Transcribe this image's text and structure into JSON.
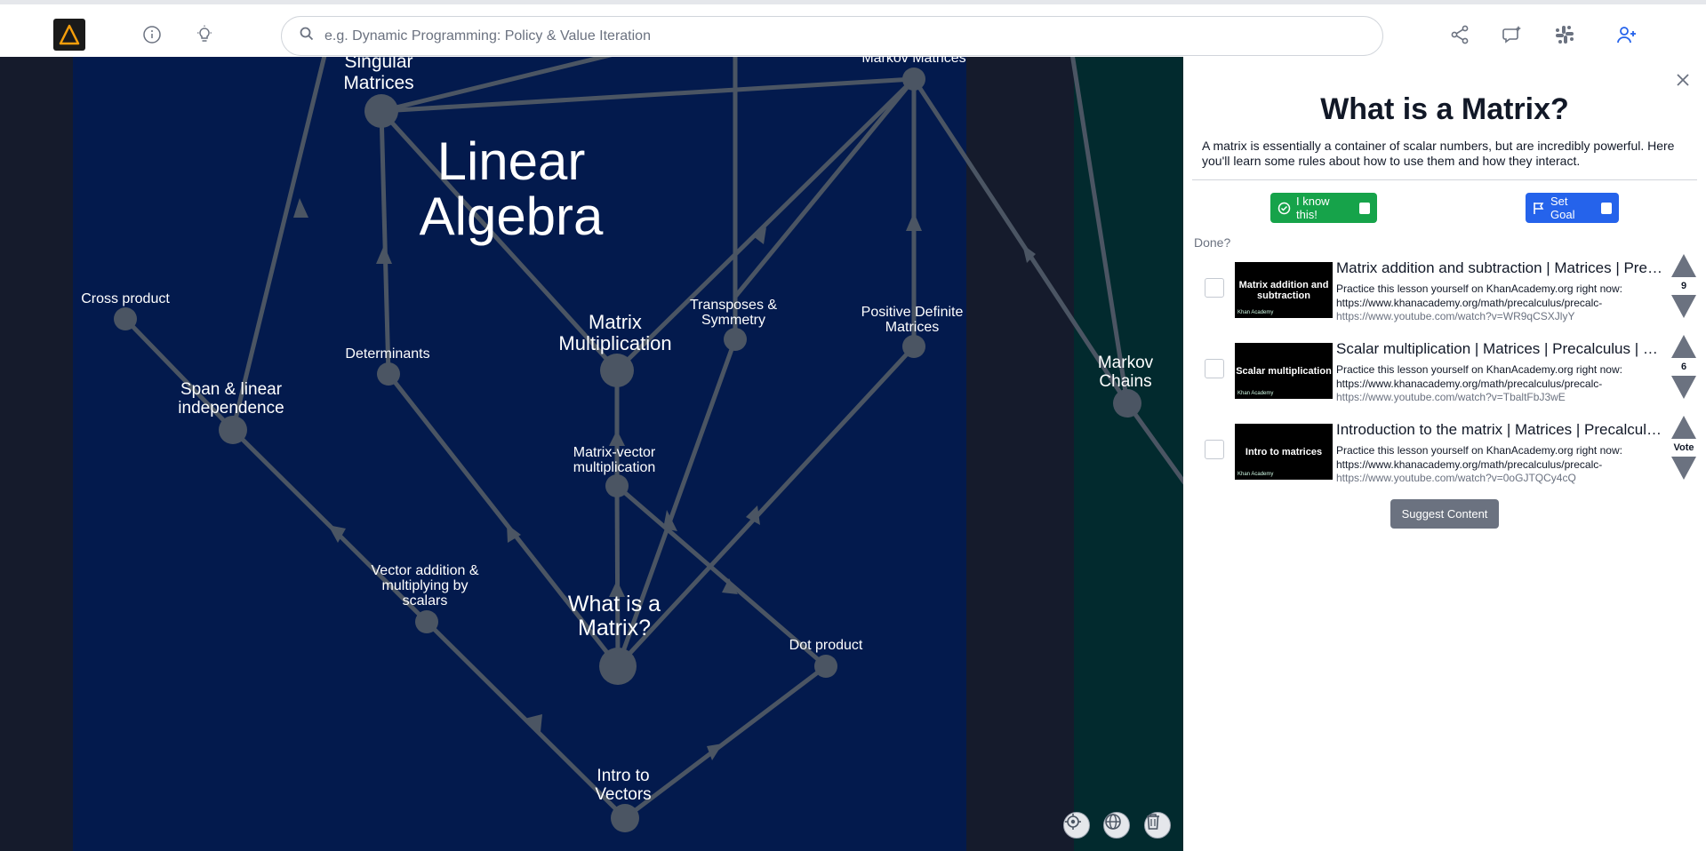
{
  "search": {
    "placeholder": "e.g. Dynamic Programming: Policy & Value Iteration"
  },
  "graph": {
    "region_title_line1": "Linear",
    "region_title_line2": "Algebra",
    "nodes": {
      "singular_matrices": [
        "Singular",
        "Matrices"
      ],
      "markov_matrices": "Markov Matrices",
      "cross_product": "Cross product",
      "span": [
        "Span & linear",
        "independence"
      ],
      "determinants": "Determinants",
      "matrix_multiplication": [
        "Matrix",
        "Multiplication"
      ],
      "transposes": [
        "Transposes &",
        "Symmetry"
      ],
      "positive_definite": [
        "Positive Definite",
        "Matrices"
      ],
      "markov_chains": [
        "Markov",
        "Chains"
      ],
      "matrix_vector": [
        "Matrix-vector",
        "multiplication"
      ],
      "vector_addition": [
        "Vector addition &",
        "multiplying by",
        "scalars"
      ],
      "what_is_matrix": [
        "What is a",
        "Matrix?"
      ],
      "dot_product": "Dot product",
      "intro_vectors": [
        "Intro to",
        "Vectors"
      ]
    }
  },
  "panel": {
    "title": "What is a Matrix?",
    "description": "A matrix is essentially a container of scalar numbers, but are incredibly powerful. Here you'll learn some rules about how to use them and how they interact.",
    "know_label": "I know this!",
    "goal_label": "Set Goal",
    "done_label": "Done?",
    "vote_label": "Vote",
    "suggest_label": "Suggest Content",
    "resources": [
      {
        "title": "Matrix addition and subtraction | Matrices | Precalculus | Khan Academy",
        "thumb_text": "Matrix addition and subtraction",
        "thumb_brand": "Khan Academy",
        "description": "Practice this lesson yourself on KhanAcademy.org right now: https://www.khanacademy.org/math/precalculus/precalc-",
        "url": "https://www.youtube.com/watch?v=WR9qCSXJlyY",
        "votes": "9"
      },
      {
        "title": "Scalar multiplication | Matrices | Precalculus | Khan Academy",
        "thumb_text": "Scalar multiplication",
        "thumb_brand": "Khan Academy",
        "description": "Practice this lesson yourself on KhanAcademy.org right now: https://www.khanacademy.org/math/precalculus/precalc-",
        "url": "https://www.youtube.com/watch?v=TbaltFbJ3wE",
        "votes": "6"
      },
      {
        "title": "Introduction to the matrix | Matrices | Precalculus | Khan Academy",
        "thumb_text": "Intro to matrices",
        "thumb_brand": "Khan Academy",
        "description": "Practice this lesson yourself on KhanAcademy.org right now: https://www.khanacademy.org/math/precalculus/precalc-",
        "url": "https://www.youtube.com/watch?v=0oGJTQCy4cQ",
        "votes": "Vote"
      }
    ]
  },
  "colors": {
    "region_linear_algebra": "#031a4d",
    "region_markov": "#022a2e",
    "background": "#151b2c",
    "node": "#4b5563",
    "edge": "#4b5563",
    "know_button": "#16a34a",
    "goal_button": "#2563eb",
    "logo_accent": "#f59e0b"
  },
  "icons": [
    "logo-delta-icon",
    "info-icon",
    "lightbulb-icon",
    "search-icon",
    "share-icon",
    "feedback-icon",
    "slack-icon",
    "add-user-icon",
    "close-icon",
    "check-circle-icon",
    "flag-icon",
    "locate-icon",
    "globe-icon",
    "trash-icon"
  ]
}
